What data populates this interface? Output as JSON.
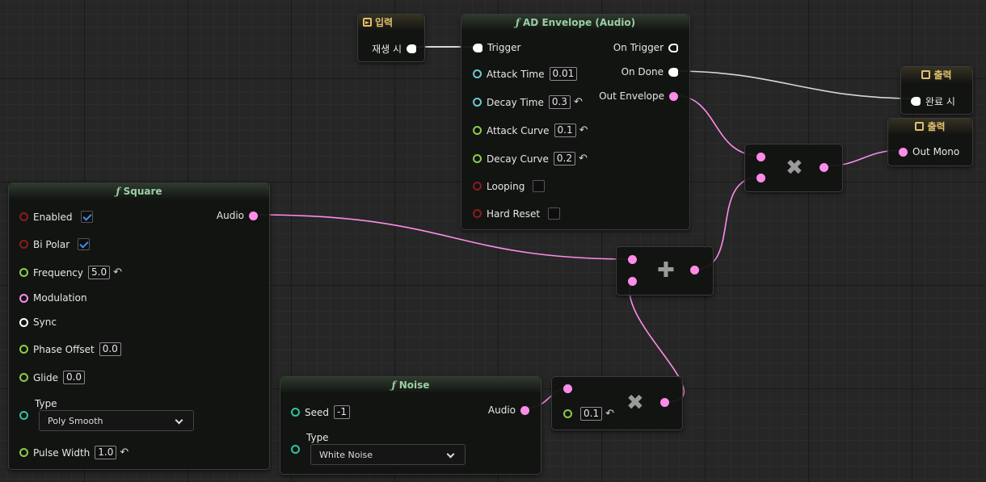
{
  "colors": {
    "audio": "#ff8ce8",
    "float": "#8ecb4a",
    "time": "#6ec8d0",
    "bool": "#8a1c1c",
    "int": "#2ec4a0",
    "exec": "#ffffff",
    "title": "#9ad0a2"
  },
  "input_node": {
    "title": "입력",
    "icon": "input-arrow-icon",
    "pin_label": "재생 시"
  },
  "ad_envelope": {
    "title": "AD Envelope (Audio)",
    "trigger": "Trigger",
    "attack_time": {
      "label": "Attack Time",
      "value": "0.01"
    },
    "decay_time": {
      "label": "Decay Time",
      "value": "0.3"
    },
    "attack_curve": {
      "label": "Attack Curve",
      "value": "0.1"
    },
    "decay_curve": {
      "label": "Decay Curve",
      "value": "0.2"
    },
    "looping": {
      "label": "Looping",
      "checked": false
    },
    "hard_reset": {
      "label": "Hard Reset",
      "checked": false
    },
    "on_trigger": "On Trigger",
    "on_done": "On Done",
    "out_envelope": "Out Envelope"
  },
  "output_done": {
    "title": "출력",
    "icon": "output-arrow-icon",
    "pin_label": "완료 시"
  },
  "output_mono": {
    "title": "출력",
    "icon": "output-arrow-icon",
    "pin_label": "Out Mono"
  },
  "square": {
    "title": "Square",
    "enabled": {
      "label": "Enabled",
      "checked": true
    },
    "bi_polar": {
      "label": "Bi Polar",
      "checked": true
    },
    "frequency": {
      "label": "Frequency",
      "value": "5.0"
    },
    "modulation": "Modulation",
    "sync": "Sync",
    "phase_offset": {
      "label": "Phase Offset",
      "value": "0.0"
    },
    "glide": {
      "label": "Glide",
      "value": "0.0"
    },
    "type_label": "Type",
    "type_value": "Poly Smooth",
    "pulse_width": {
      "label": "Pulse Width",
      "value": "1.0"
    },
    "audio_out": "Audio"
  },
  "noise": {
    "title": "Noise",
    "seed": {
      "label": "Seed",
      "value": "-1"
    },
    "type_label": "Type",
    "type_value": "White Noise",
    "audio_out": "Audio"
  },
  "multiply_bottom": {
    "value": "0.1",
    "symbol": "✖"
  },
  "add_node": {
    "symbol": "✚"
  },
  "multiply_top": {
    "symbol": "✖"
  }
}
